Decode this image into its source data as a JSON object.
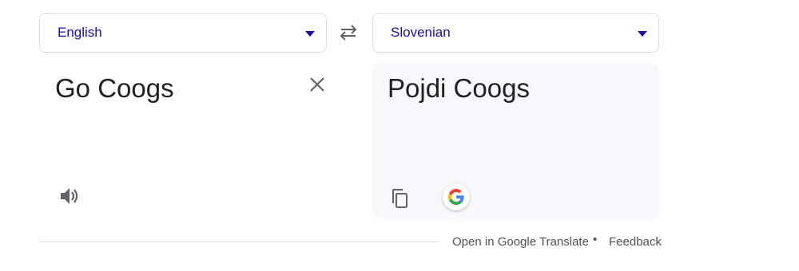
{
  "source_language": {
    "label": "English",
    "icon": "chevron-down-icon"
  },
  "target_language": {
    "label": "Slovenian",
    "icon": "chevron-down-icon"
  },
  "swap": {
    "icon": "swap-arrows-icon"
  },
  "source": {
    "text": "Go Coogs",
    "clear_icon": "close-icon",
    "listen_icon": "speaker-icon"
  },
  "result": {
    "text": "Pojdi Coogs",
    "copy_icon": "copy-icon",
    "google_icon": "google-g-icon"
  },
  "footer": {
    "open_label": "Open in Google Translate",
    "separator": "•",
    "feedback_label": "Feedback"
  },
  "colors": {
    "accent": "#1a0dab",
    "panel_bg": "#f6f8fb",
    "border": "#dadce0",
    "text": "#202124",
    "muted": "#4d5156"
  }
}
